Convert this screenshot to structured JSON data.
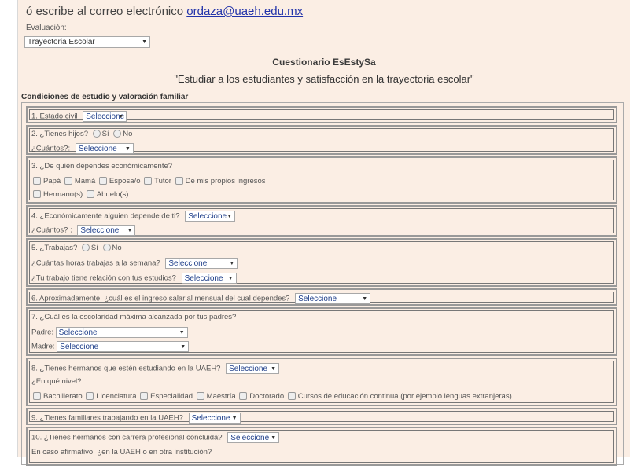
{
  "header": {
    "text": "ó escribe al correo electrónico",
    "email": "ordaza@uaeh.edu.mx"
  },
  "evaluation": {
    "label": "Evaluación:",
    "selected": "Trayectoria Escolar"
  },
  "title": "Cuestionario EsEstySa",
  "subtitle": "\"Estudiar a los estudiantes y satisfacción en la trayectoria escolar\"",
  "section": "Condiciones de estudio y valoración familiar",
  "sel": "Seleccione",
  "q1": {
    "label": "1. Estado civil"
  },
  "q2": {
    "label": "2. ¿Tienes hijos?",
    "yes": "Sí",
    "no": "No",
    "sub": "¿Cuántos?:"
  },
  "q3": {
    "label": "3. ¿De quién dependes económicamente?",
    "options": [
      "Papá",
      "Mamá",
      "Esposa/o",
      "Tutor",
      "De mis propios ingresos",
      "Hermano(s)",
      "Abuelo(s)"
    ]
  },
  "q4": {
    "label": "4. ¿Económicamente alguien depende de ti?",
    "sub": "¿Cuántos? :"
  },
  "q5": {
    "label": "5. ¿Trabajas?",
    "yes": "Sí",
    "no": "No",
    "sub1": "¿Cuántas horas trabajas a la semana?",
    "sub2": "¿Tu trabajo tiene relación con tus estudios?"
  },
  "q6": {
    "label": "6. Aproximadamente, ¿cuál es el ingreso salarial mensual del cual dependes?"
  },
  "q7": {
    "label": "7. ¿Cuál es la escolaridad máxima alcanzada por tus padres?",
    "father": "Padre:",
    "mother": "Madre:"
  },
  "q8": {
    "label": "8. ¿Tienes hermanos que estén estudiando en la UAEH?",
    "sub": "¿En qué nivel?",
    "options": [
      "Bachillerato",
      "Licenciatura",
      "Especialidad",
      "Maestría",
      "Doctorado",
      "Cursos de educación continua (por ejemplo lenguas extranjeras)"
    ]
  },
  "q9": {
    "label": "9. ¿Tienes familiares trabajando en la UAEH?"
  },
  "q10": {
    "label": "10. ¿Tienes hermanos con carrera profesional concluida?",
    "sub": "En caso afirmativo, ¿en la UAEH o en otra institución?"
  }
}
